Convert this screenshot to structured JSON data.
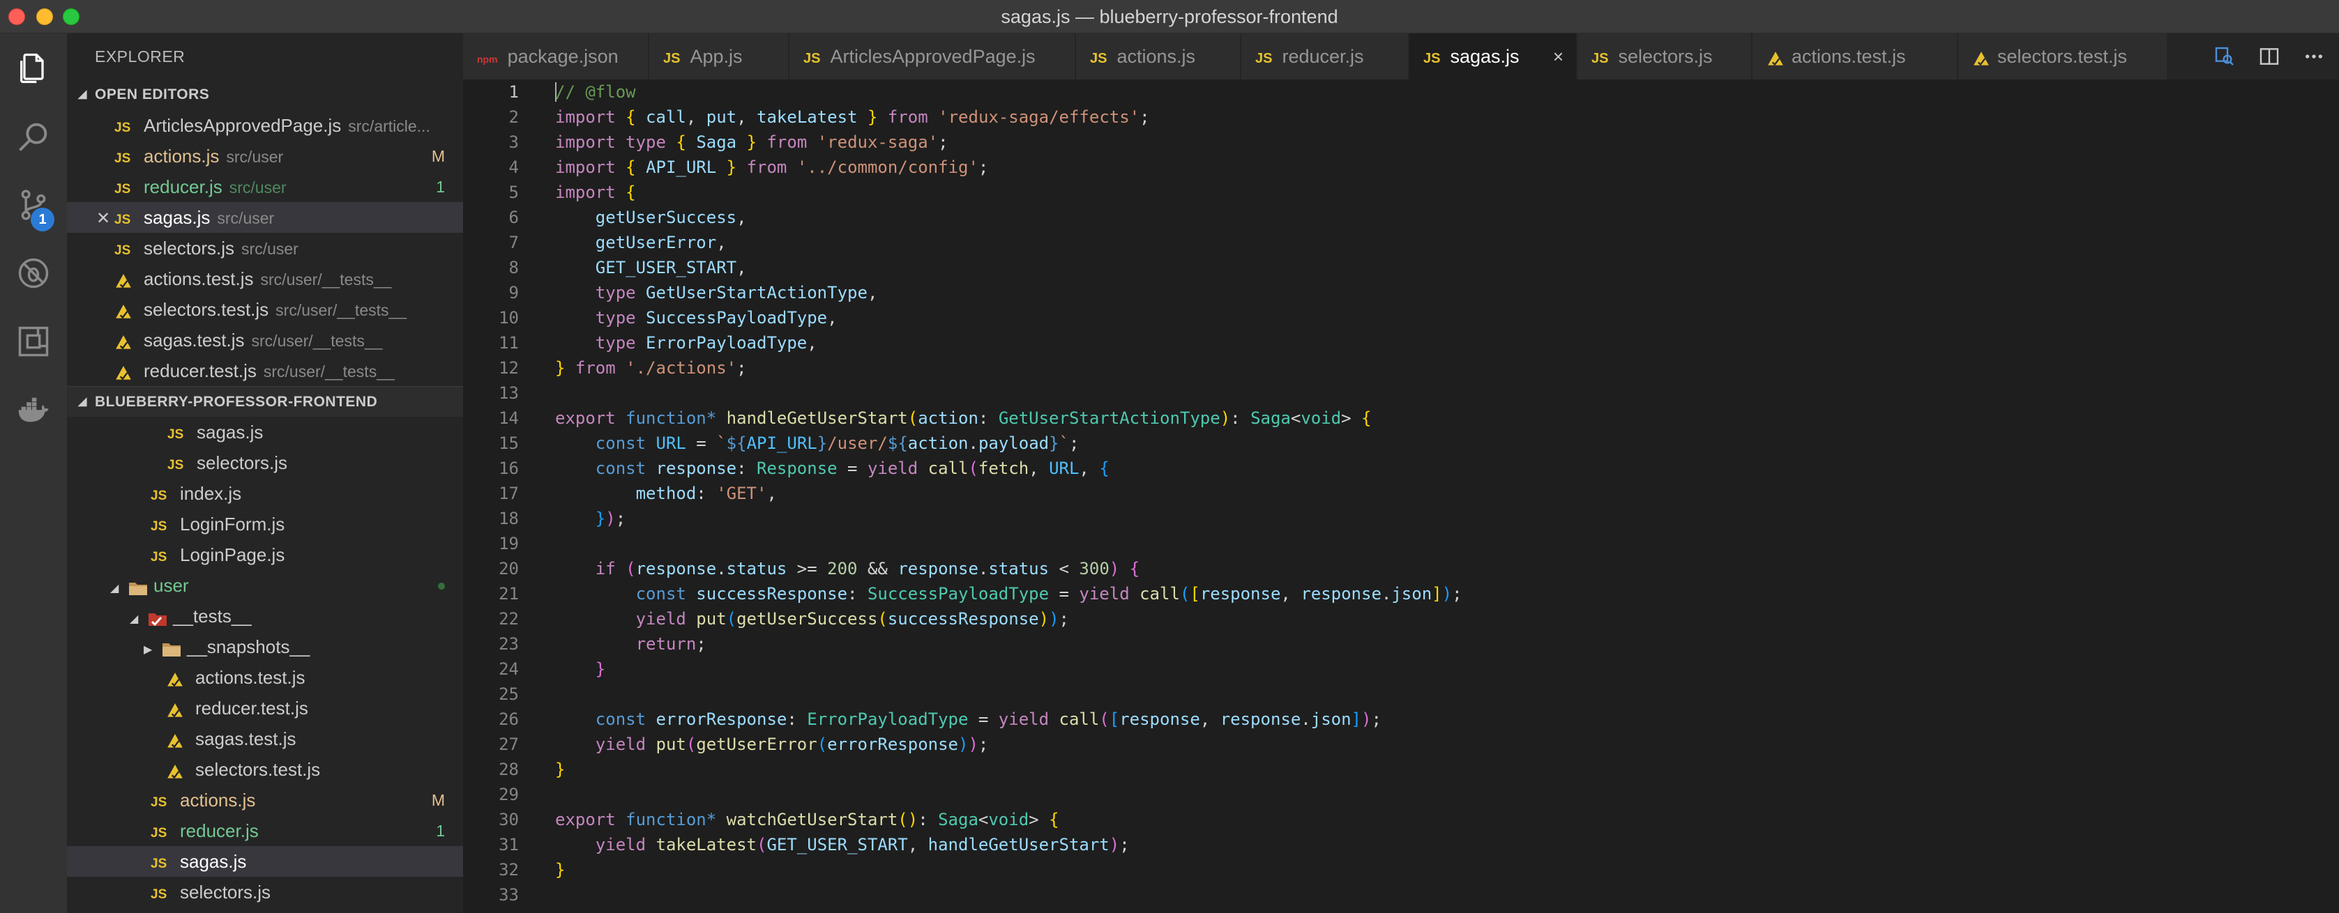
{
  "window": {
    "title": "sagas.js — blueberry-professor-frontend"
  },
  "explorer": {
    "title": "EXPLORER",
    "open_editors_header": "OPEN EDITORS",
    "project_header": "BLUEBERRY-PROFESSOR-FRONTEND",
    "scm_badge": "1",
    "open_editors": [
      {
        "name": "ArticlesApprovedPage.js",
        "path": "src/article...",
        "icon": "js-icon"
      },
      {
        "name": "actions.js",
        "path": "src/user",
        "icon": "js-icon",
        "mark": "M"
      },
      {
        "name": "reducer.js",
        "path": "src/user",
        "icon": "js-icon",
        "mark": "1"
      },
      {
        "name": "sagas.js",
        "path": "src/user",
        "icon": "js-icon"
      },
      {
        "name": "selectors.js",
        "path": "src/user",
        "icon": "js-icon"
      },
      {
        "name": "actions.test.js",
        "path": "src/user/__tests__",
        "icon": "test-icon"
      },
      {
        "name": "selectors.test.js",
        "path": "src/user/__tests__",
        "icon": "test-icon"
      },
      {
        "name": "sagas.test.js",
        "path": "src/user/__tests__",
        "icon": "test-icon"
      },
      {
        "name": "reducer.test.js",
        "path": "src/user/__tests__",
        "icon": "test-icon"
      }
    ],
    "tree": [
      {
        "name": "sagas.js",
        "icon": "js-icon"
      },
      {
        "name": "selectors.js",
        "icon": "js-icon"
      },
      {
        "name": "index.js",
        "icon": "js-icon"
      },
      {
        "name": "LoginForm.js",
        "icon": "js-icon"
      },
      {
        "name": "LoginPage.js",
        "icon": "js-icon"
      },
      {
        "name": "user",
        "icon": "folder-open-icon"
      },
      {
        "name": "__tests__",
        "icon": "test-folder-icon"
      },
      {
        "name": "__snapshots__",
        "icon": "folder-icon"
      },
      {
        "name": "actions.test.js",
        "icon": "test-icon"
      },
      {
        "name": "reducer.test.js",
        "icon": "test-icon"
      },
      {
        "name": "sagas.test.js",
        "icon": "test-icon"
      },
      {
        "name": "selectors.test.js",
        "icon": "test-icon"
      },
      {
        "name": "actions.js",
        "icon": "js-icon",
        "mark": "M"
      },
      {
        "name": "reducer.js",
        "icon": "js-icon",
        "mark": "1"
      },
      {
        "name": "sagas.js",
        "icon": "js-icon"
      },
      {
        "name": "selectors.js",
        "icon": "js-icon"
      }
    ]
  },
  "tabs": [
    {
      "label": "package.json",
      "icon_text": "npm"
    },
    {
      "label": "App.js",
      "icon_text": "JS"
    },
    {
      "label": "ArticlesApprovedPage.js",
      "icon_text": "JS"
    },
    {
      "label": "actions.js",
      "icon_text": "JS"
    },
    {
      "label": "reducer.js",
      "icon_text": "JS"
    },
    {
      "label": "sagas.js",
      "icon_text": "JS",
      "close": "×"
    },
    {
      "label": "selectors.js",
      "icon_text": "JS"
    },
    {
      "label": "actions.test.js",
      "icon_text": ""
    },
    {
      "label": "selectors.test.js",
      "icon_text": ""
    }
  ],
  "js_badge": "JS",
  "code_lines": [
    [
      [
        "t-cm",
        "// @flow"
      ]
    ],
    [
      [
        "t-kw",
        "import"
      ],
      [
        "",
        " "
      ],
      [
        "t-br1",
        "{"
      ],
      [
        "t-var",
        " call"
      ],
      [
        "",
        ", "
      ],
      [
        "t-var",
        "put"
      ],
      [
        "",
        ", "
      ],
      [
        "t-var",
        "takeLatest"
      ],
      [
        "",
        " "
      ],
      [
        "t-br1",
        "}"
      ],
      [
        "",
        " "
      ],
      [
        "t-kw",
        "from"
      ],
      [
        "",
        " "
      ],
      [
        "t-str",
        "'redux-saga/effects'"
      ],
      [
        "",
        ";"
      ]
    ],
    [
      [
        "t-kw",
        "import"
      ],
      [
        "",
        " "
      ],
      [
        "t-kw",
        "type"
      ],
      [
        "",
        " "
      ],
      [
        "t-br1",
        "{"
      ],
      [
        "",
        " "
      ],
      [
        "t-var",
        "Saga"
      ],
      [
        "",
        " "
      ],
      [
        "t-br1",
        "}"
      ],
      [
        "",
        " "
      ],
      [
        "t-kw",
        "from"
      ],
      [
        "",
        " "
      ],
      [
        "t-str",
        "'redux-saga'"
      ],
      [
        "",
        ";"
      ]
    ],
    [
      [
        "t-kw",
        "import"
      ],
      [
        "",
        " "
      ],
      [
        "t-br1",
        "{"
      ],
      [
        "",
        " "
      ],
      [
        "t-var",
        "API_URL"
      ],
      [
        "",
        " "
      ],
      [
        "t-br1",
        "}"
      ],
      [
        "",
        " "
      ],
      [
        "t-kw",
        "from"
      ],
      [
        "",
        " "
      ],
      [
        "t-str",
        "'../common/config'"
      ],
      [
        "",
        ";"
      ]
    ],
    [
      [
        "t-kw",
        "import"
      ],
      [
        "",
        " "
      ],
      [
        "t-br1",
        "{"
      ]
    ],
    [
      [
        "",
        "    "
      ],
      [
        "t-var",
        "getUserSuccess"
      ],
      [
        "",
        ","
      ]
    ],
    [
      [
        "",
        "    "
      ],
      [
        "t-var",
        "getUserError"
      ],
      [
        "",
        ","
      ]
    ],
    [
      [
        "",
        "    "
      ],
      [
        "t-var",
        "GET_USER_START"
      ],
      [
        "",
        ","
      ]
    ],
    [
      [
        "",
        "    "
      ],
      [
        "t-kw",
        "type"
      ],
      [
        "",
        " "
      ],
      [
        "t-var",
        "GetUserStartActionType"
      ],
      [
        "",
        ","
      ]
    ],
    [
      [
        "",
        "    "
      ],
      [
        "t-kw",
        "type"
      ],
      [
        "",
        " "
      ],
      [
        "t-var",
        "SuccessPayloadType"
      ],
      [
        "",
        ","
      ]
    ],
    [
      [
        "",
        "    "
      ],
      [
        "t-kw",
        "type"
      ],
      [
        "",
        " "
      ],
      [
        "t-var",
        "ErrorPayloadType"
      ],
      [
        "",
        ","
      ]
    ],
    [
      [
        "t-br1",
        "}"
      ],
      [
        "",
        " "
      ],
      [
        "t-kw",
        "from"
      ],
      [
        "",
        " "
      ],
      [
        "t-str",
        "'./actions'"
      ],
      [
        "",
        ";"
      ]
    ],
    [],
    [
      [
        "t-kw",
        "export"
      ],
      [
        "",
        " "
      ],
      [
        "t-kw2",
        "function*"
      ],
      [
        "",
        " "
      ],
      [
        "t-fn",
        "handleGetUserStart"
      ],
      [
        "t-br1",
        "("
      ],
      [
        "t-var",
        "action"
      ],
      [
        "",
        ": "
      ],
      [
        "t-type",
        "GetUserStartActionType"
      ],
      [
        "t-br1",
        ")"
      ],
      [
        "",
        ": "
      ],
      [
        "t-type",
        "Saga"
      ],
      [
        "",
        "<"
      ],
      [
        "t-type",
        "void"
      ],
      [
        "",
        "> "
      ],
      [
        "t-br1",
        "{"
      ]
    ],
    [
      [
        "",
        "    "
      ],
      [
        "t-kw2",
        "const"
      ],
      [
        "",
        " "
      ],
      [
        "t-const",
        "URL"
      ],
      [
        "",
        " = "
      ],
      [
        "t-str",
        "`"
      ],
      [
        "t-kw2",
        "${"
      ],
      [
        "t-const",
        "API_URL"
      ],
      [
        "t-kw2",
        "}"
      ],
      [
        "t-str",
        "/user/"
      ],
      [
        "t-kw2",
        "${"
      ],
      [
        "t-var",
        "action"
      ],
      [
        "",
        "."
      ],
      [
        "t-var",
        "payload"
      ],
      [
        "t-kw2",
        "}"
      ],
      [
        "t-str",
        "`"
      ],
      [
        "",
        ";"
      ]
    ],
    [
      [
        "",
        "    "
      ],
      [
        "t-kw2",
        "const"
      ],
      [
        "",
        " "
      ],
      [
        "t-var",
        "response"
      ],
      [
        "",
        ": "
      ],
      [
        "t-type",
        "Response"
      ],
      [
        "",
        " = "
      ],
      [
        "t-kw",
        "yield"
      ],
      [
        "",
        " "
      ],
      [
        "t-fn",
        "call"
      ],
      [
        "t-br2",
        "("
      ],
      [
        "t-fn",
        "fetch"
      ],
      [
        "",
        ", "
      ],
      [
        "t-const",
        "URL"
      ],
      [
        "",
        ", "
      ],
      [
        "t-br3",
        "{"
      ]
    ],
    [
      [
        "",
        "        "
      ],
      [
        "t-var",
        "method"
      ],
      [
        "",
        ": "
      ],
      [
        "t-str",
        "'GET'"
      ],
      [
        "",
        ","
      ]
    ],
    [
      [
        "",
        "    "
      ],
      [
        "t-br3",
        "}"
      ],
      [
        "t-br2",
        ")"
      ],
      [
        "",
        ";"
      ]
    ],
    [],
    [
      [
        "",
        "    "
      ],
      [
        "t-kw",
        "if"
      ],
      [
        "",
        " "
      ],
      [
        "t-br2",
        "("
      ],
      [
        "t-var",
        "response"
      ],
      [
        "",
        "."
      ],
      [
        "t-var",
        "status"
      ],
      [
        "",
        " >= "
      ],
      [
        "t-num",
        "200"
      ],
      [
        "",
        " && "
      ],
      [
        "t-var",
        "response"
      ],
      [
        "",
        "."
      ],
      [
        "t-var",
        "status"
      ],
      [
        "",
        " < "
      ],
      [
        "t-num",
        "300"
      ],
      [
        "t-br2",
        ")"
      ],
      [
        "",
        " "
      ],
      [
        "t-br2",
        "{"
      ]
    ],
    [
      [
        "",
        "        "
      ],
      [
        "t-kw2",
        "const"
      ],
      [
        "",
        " "
      ],
      [
        "t-var",
        "successResponse"
      ],
      [
        "",
        ": "
      ],
      [
        "t-type",
        "SuccessPayloadType"
      ],
      [
        "",
        " = "
      ],
      [
        "t-kw",
        "yield"
      ],
      [
        "",
        " "
      ],
      [
        "t-fn",
        "call"
      ],
      [
        "t-br3",
        "("
      ],
      [
        "t-br1",
        "["
      ],
      [
        "t-var",
        "response"
      ],
      [
        "",
        ", "
      ],
      [
        "t-var",
        "response"
      ],
      [
        "",
        "."
      ],
      [
        "t-var",
        "json"
      ],
      [
        "t-br1",
        "]"
      ],
      [
        "t-br3",
        ")"
      ],
      [
        "",
        ";"
      ]
    ],
    [
      [
        "",
        "        "
      ],
      [
        "t-kw",
        "yield"
      ],
      [
        "",
        " "
      ],
      [
        "t-fn",
        "put"
      ],
      [
        "t-br3",
        "("
      ],
      [
        "t-fn",
        "getUserSuccess"
      ],
      [
        "t-br1",
        "("
      ],
      [
        "t-var",
        "successResponse"
      ],
      [
        "t-br1",
        ")"
      ],
      [
        "t-br3",
        ")"
      ],
      [
        "",
        ";"
      ]
    ],
    [
      [
        "",
        "        "
      ],
      [
        "t-kw",
        "return"
      ],
      [
        "",
        ";"
      ]
    ],
    [
      [
        "",
        "    "
      ],
      [
        "t-br2",
        "}"
      ]
    ],
    [],
    [
      [
        "",
        "    "
      ],
      [
        "t-kw2",
        "const"
      ],
      [
        "",
        " "
      ],
      [
        "t-var",
        "errorResponse"
      ],
      [
        "",
        ": "
      ],
      [
        "t-type",
        "ErrorPayloadType"
      ],
      [
        "",
        " = "
      ],
      [
        "t-kw",
        "yield"
      ],
      [
        "",
        " "
      ],
      [
        "t-fn",
        "call"
      ],
      [
        "t-br2",
        "("
      ],
      [
        "t-br3",
        "["
      ],
      [
        "t-var",
        "response"
      ],
      [
        "",
        ", "
      ],
      [
        "t-var",
        "response"
      ],
      [
        "",
        "."
      ],
      [
        "t-var",
        "json"
      ],
      [
        "t-br3",
        "]"
      ],
      [
        "t-br2",
        ")"
      ],
      [
        "",
        ";"
      ]
    ],
    [
      [
        "",
        "    "
      ],
      [
        "t-kw",
        "yield"
      ],
      [
        "",
        " "
      ],
      [
        "t-fn",
        "put"
      ],
      [
        "t-br2",
        "("
      ],
      [
        "t-fn",
        "getUserError"
      ],
      [
        "t-br3",
        "("
      ],
      [
        "t-var",
        "errorResponse"
      ],
      [
        "t-br3",
        ")"
      ],
      [
        "t-br2",
        ")"
      ],
      [
        "",
        ";"
      ]
    ],
    [
      [
        "t-br1",
        "}"
      ]
    ],
    [],
    [
      [
        "t-kw",
        "export"
      ],
      [
        "",
        " "
      ],
      [
        "t-kw2",
        "function*"
      ],
      [
        "",
        " "
      ],
      [
        "t-fn",
        "watchGetUserStart"
      ],
      [
        "t-br1",
        "()"
      ],
      [
        "",
        ": "
      ],
      [
        "t-type",
        "Saga"
      ],
      [
        "",
        "<"
      ],
      [
        "t-type",
        "void"
      ],
      [
        "",
        "> "
      ],
      [
        "t-br1",
        "{"
      ]
    ],
    [
      [
        "",
        "    "
      ],
      [
        "t-kw",
        "yield"
      ],
      [
        "",
        " "
      ],
      [
        "t-fn",
        "takeLatest"
      ],
      [
        "t-br2",
        "("
      ],
      [
        "t-var",
        "GET_USER_START"
      ],
      [
        "",
        ", "
      ],
      [
        "t-var",
        "handleGetUserStart"
      ],
      [
        "t-br2",
        ")"
      ],
      [
        "",
        ";"
      ]
    ],
    [
      [
        "t-br1",
        "}"
      ]
    ],
    []
  ]
}
